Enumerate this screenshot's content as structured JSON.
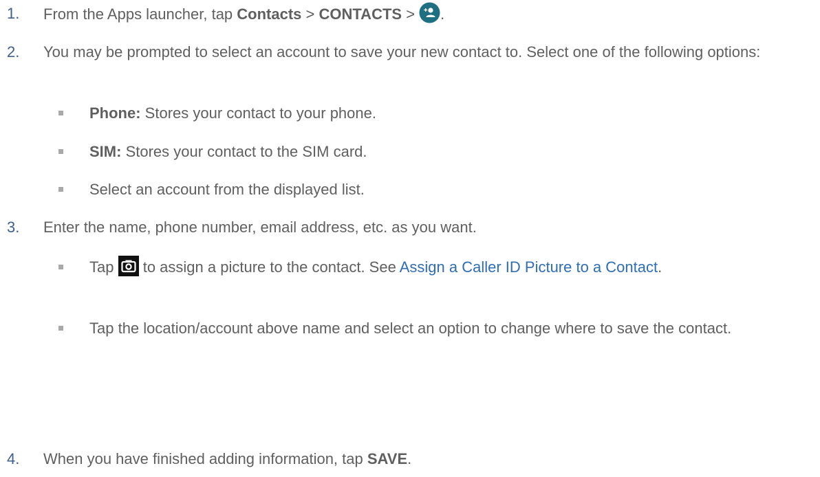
{
  "steps": [
    {
      "number": "1.",
      "text_before": "From the Apps launcher, tap ",
      "bold1": "Contacts",
      "sep1": " > ",
      "bold2": "CONTACTS",
      "sep2": " > ",
      "icon": "add-contact-icon",
      "text_after": "."
    },
    {
      "number": "2.",
      "text": "You may be prompted to select an account to save your new contact to. Select one of the following options:",
      "bullets": [
        {
          "bold": "Phone:",
          "text": " Stores your contact to your phone."
        },
        {
          "bold": "SIM:",
          "text": " Stores your contact to the SIM card."
        },
        {
          "bold": "",
          "text": "Select an account from the displayed list."
        }
      ]
    },
    {
      "number": "3.",
      "text": "Enter the name, phone number, email address, etc. as you want.",
      "bullets": [
        {
          "text_before": "Tap ",
          "icon": "camera-icon",
          "text_mid": " to assign a picture to the contact. See ",
          "link": "Assign a Caller ID Picture to a Contact",
          "text_after": "."
        },
        {
          "text": "Tap the location/account above name and select an option to change where to save the contact."
        }
      ]
    },
    {
      "number": "4.",
      "text_before": "When you have finished adding information, tap ",
      "bold": "SAVE",
      "text_after": "."
    }
  ],
  "colors": {
    "text": "#5f5f5f",
    "number": "#3f5f8f",
    "link": "#2f6db5",
    "add_contact_icon_bg": "#1f6f83",
    "camera_icon_bg": "#111111"
  }
}
